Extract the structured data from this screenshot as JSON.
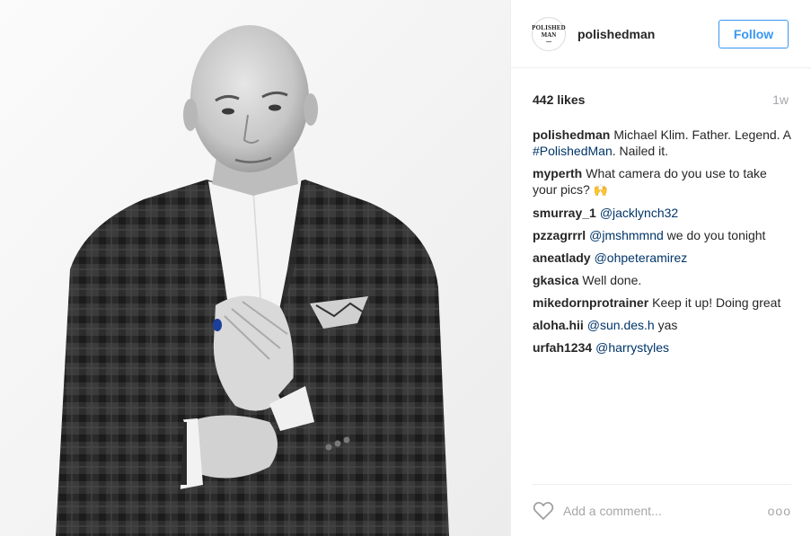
{
  "profile": {
    "username": "polishedman",
    "avatar_line1": "POLISHED",
    "avatar_line2": "MAN",
    "follow_label": "Follow"
  },
  "post": {
    "likes": "442 likes",
    "time_ago": "1w"
  },
  "comments": [
    {
      "user": "polishedman",
      "text": "Michael Klim. Father. Legend. A ",
      "link": "#PolishedMan",
      "after": ". Nailed it."
    },
    {
      "user": "myperth",
      "text": "What camera do you use to take your pics? ",
      "emoji": "🙌"
    },
    {
      "user": "smurray_1",
      "text": "",
      "link": "@jacklynch32",
      "after": ""
    },
    {
      "user": "pzzagrrrl",
      "text": "",
      "link": "@jmshmmnd",
      "after": " we do you tonight"
    },
    {
      "user": "aneatlady",
      "text": "",
      "link": "@ohpeteramirez",
      "after": ""
    },
    {
      "user": "gkasica",
      "text": "Well done.",
      "after": ""
    },
    {
      "user": "mikedornprotrainer",
      "text": "Keep it up! Doing great",
      "after": ""
    },
    {
      "user": "aloha.hii",
      "text": "",
      "link": "@sun.des.h",
      "after": " yas"
    },
    {
      "user": "urfah1234",
      "text": "",
      "link": "@harrystyles",
      "after": ""
    }
  ],
  "footer": {
    "comment_placeholder": "Add a comment...",
    "more_label": "ooo"
  },
  "icons": {
    "heart": "heart-icon",
    "more": "more-options-icon"
  },
  "colors": {
    "accent": "#3897f0",
    "link": "#003569",
    "muted": "#a5a7aa"
  }
}
